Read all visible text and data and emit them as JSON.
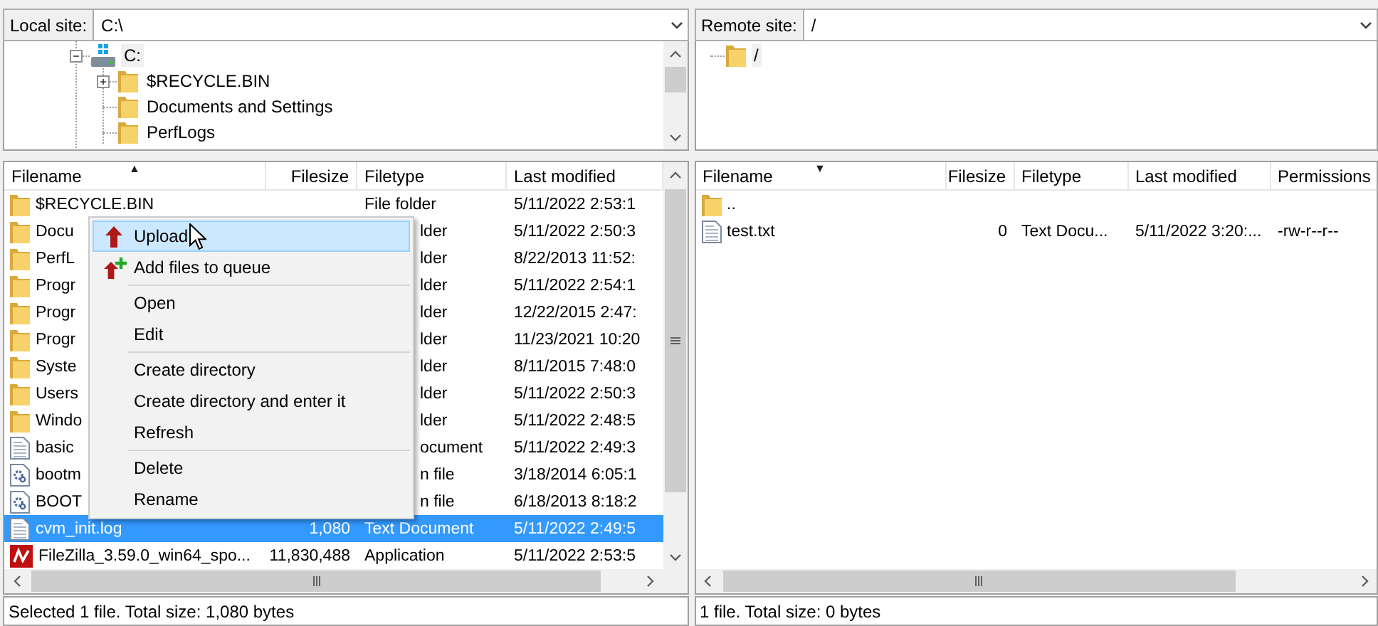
{
  "local": {
    "site_label": "Local site:",
    "path": "C:\\",
    "tree": [
      {
        "label": "C:",
        "kind": "drive",
        "expanded": true,
        "selected": true,
        "children": [
          {
            "label": "$RECYCLE.BIN",
            "kind": "folder",
            "expanded": false,
            "selected": false
          },
          {
            "label": "Documents and Settings",
            "kind": "folder",
            "selected": false
          },
          {
            "label": "PerfLogs",
            "kind": "folder",
            "selected": false
          }
        ]
      }
    ],
    "list": {
      "columns": [
        {
          "label": "Filename",
          "sort_arrow": "▲"
        },
        {
          "label": "Filesize"
        },
        {
          "label": "Filetype"
        },
        {
          "label": "Last modified"
        }
      ],
      "rows": [
        {
          "kind": "folder",
          "filename": "$RECYCLE.BIN",
          "filetype": "File folder",
          "last_modified": "5/11/2022 2:53:1",
          "selected": false
        },
        {
          "kind": "folder",
          "filename": "Docu",
          "filetype": "lder",
          "last_modified": "5/11/2022 2:50:3",
          "selected": false
        },
        {
          "kind": "folder",
          "filename": "PerfL",
          "filetype": "lder",
          "last_modified": "8/22/2013 11:52:",
          "selected": false
        },
        {
          "kind": "folder",
          "filename": "Progr",
          "filetype": "lder",
          "last_modified": "5/11/2022 2:54:1",
          "selected": false
        },
        {
          "kind": "folder",
          "filename": "Progr",
          "filetype": "lder",
          "last_modified": "12/22/2015 2:47:",
          "selected": false
        },
        {
          "kind": "folder",
          "filename": "Progr",
          "filetype": "lder",
          "last_modified": "11/23/2021 10:20",
          "selected": false
        },
        {
          "kind": "folder",
          "filename": "Syste",
          "filetype": "lder",
          "last_modified": "8/11/2015 7:48:0",
          "selected": false
        },
        {
          "kind": "folder",
          "filename": "Users",
          "filetype": "lder",
          "last_modified": "5/11/2022 2:50:3",
          "selected": false
        },
        {
          "kind": "folder",
          "filename": "Windo",
          "filetype": "lder",
          "last_modified": "5/11/2022 2:48:5",
          "selected": false
        },
        {
          "kind": "text",
          "filename": "basic",
          "filetype": "ocument",
          "last_modified": "5/11/2022 2:49:3",
          "selected": false
        },
        {
          "kind": "system",
          "filename": "bootm",
          "filetype": "n file",
          "last_modified": "3/18/2014 6:05:1",
          "selected": false
        },
        {
          "kind": "system",
          "filename": "BOOT",
          "filetype": "n file",
          "last_modified": "6/18/2013 8:18:2",
          "selected": false
        },
        {
          "kind": "text",
          "filename": "cvm_init.log",
          "filesize": "1,080",
          "filetype": "Text Document",
          "last_modified": "5/11/2022 2:49:5",
          "selected": true
        },
        {
          "kind": "app",
          "filename": "FileZilla_3.59.0_win64_spo...",
          "filesize": "11,830,488",
          "filetype": "Application",
          "last_modified": "5/11/2022 2:53:5",
          "selected": false
        }
      ]
    },
    "status": "Selected 1 file. Total size: 1,080 bytes"
  },
  "remote": {
    "site_label": "Remote site:",
    "path": "/",
    "tree": [
      {
        "label": "/",
        "kind": "folder",
        "selected": true
      }
    ],
    "list": {
      "columns": [
        {
          "label": "Filename",
          "sort_arrow": "▼"
        },
        {
          "label": "Filesize"
        },
        {
          "label": "Filetype"
        },
        {
          "label": "Last modified"
        },
        {
          "label": "Permissions"
        }
      ],
      "rows": [
        {
          "kind": "folder",
          "filename": "..",
          "selected": false
        },
        {
          "kind": "text",
          "filename": "test.txt",
          "filesize": "0",
          "filetype": "Text Docu...",
          "last_modified": "5/11/2022 3:20:...",
          "permissions": "-rw-r--r--",
          "selected": false
        }
      ]
    },
    "status": "1 file. Total size: 0 bytes"
  },
  "context_menu": {
    "items": [
      {
        "kind": "upload_item",
        "label": "Upload",
        "selected": true
      },
      {
        "kind": "queue_item",
        "label": "Add files to queue",
        "selected": false
      },
      {
        "kind": "separator"
      },
      {
        "kind": "item",
        "label": "Open",
        "selected": false
      },
      {
        "kind": "item",
        "label": "Edit",
        "selected": false
      },
      {
        "kind": "separator"
      },
      {
        "kind": "item",
        "label": "Create directory",
        "selected": false
      },
      {
        "kind": "item",
        "label": "Create directory and enter it",
        "selected": false
      },
      {
        "kind": "item",
        "label": "Refresh",
        "selected": false
      },
      {
        "kind": "separator"
      },
      {
        "kind": "item",
        "label": "Delete",
        "selected": false
      },
      {
        "kind": "item",
        "label": "Rename",
        "selected": false
      }
    ]
  }
}
